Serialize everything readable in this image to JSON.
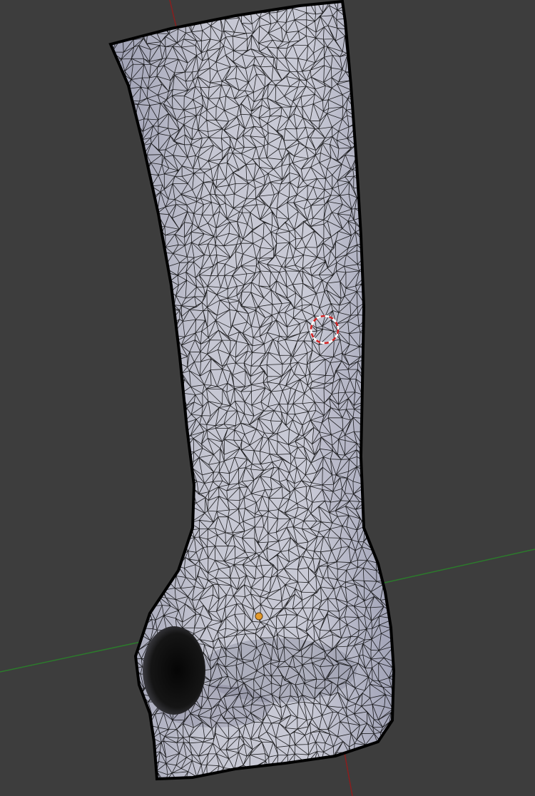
{
  "viewport": {
    "background_color": "#3d3d3d",
    "mesh_fill_color": "#c3c4d0",
    "mesh_shadow_color": "#8b8da0",
    "wireframe_color": "#000000",
    "x_axis_color": "#8a1e1e",
    "y_axis_color": "#2c7a2c",
    "origin_color": "#e39a2c",
    "cursor_colors": [
      "#d22222",
      "#ffffff"
    ]
  },
  "scene": {
    "object": "cast-mesh",
    "display_mode": "wireframe-over-solid",
    "has_3d_cursor": true,
    "has_origin_point": true,
    "has_floor_axes": true
  }
}
